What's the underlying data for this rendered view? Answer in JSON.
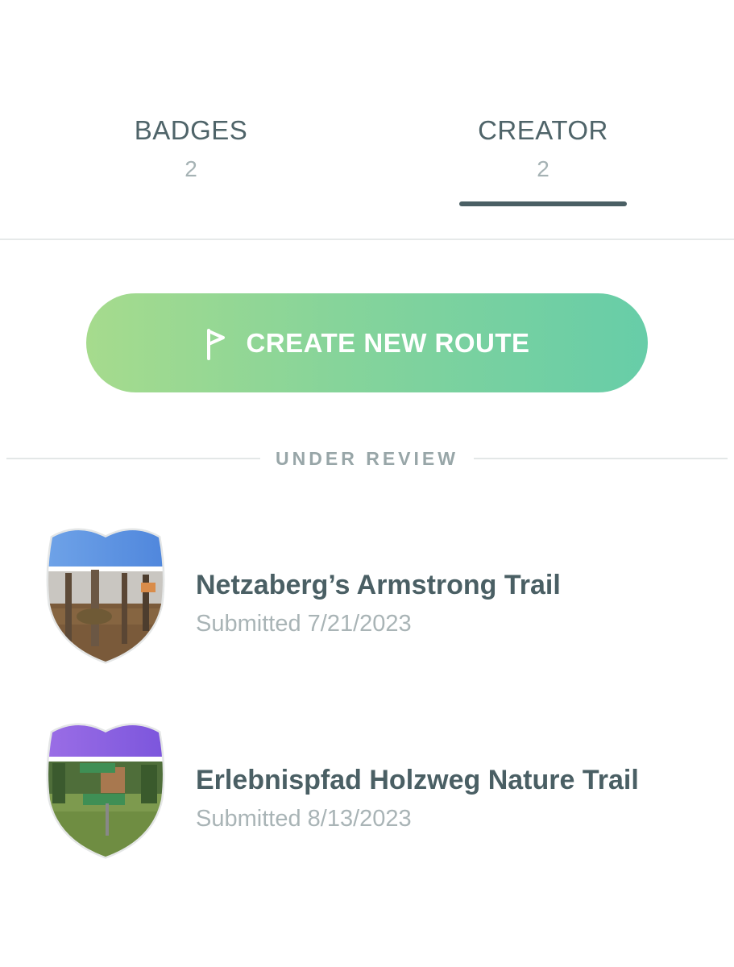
{
  "tabs": [
    {
      "label": "BADGES",
      "count": "2",
      "active": false
    },
    {
      "label": "CREATOR",
      "count": "2",
      "active": true
    }
  ],
  "create_button": {
    "label": "CREATE NEW ROUTE",
    "icon": "flag-icon"
  },
  "section": {
    "title": "UNDER REVIEW"
  },
  "routes": [
    {
      "name": "Netzaberg’s Armstrong Trail",
      "submitted": "Submitted 7/21/2023",
      "badge_icon": "route-badge-icon",
      "badge_band_color": "#5b8fe0"
    },
    {
      "name": "Erlebnispfad Holzweg Nature Trail",
      "submitted": "Submitted 8/13/2023",
      "badge_icon": "route-badge-icon",
      "badge_band_color": "#8a5ee0"
    }
  ],
  "colors": {
    "text_primary": "#4a5f64",
    "text_muted": "#a9b4b6",
    "button_gradient_start": "#a6db8d",
    "button_gradient_end": "#67cda8"
  }
}
